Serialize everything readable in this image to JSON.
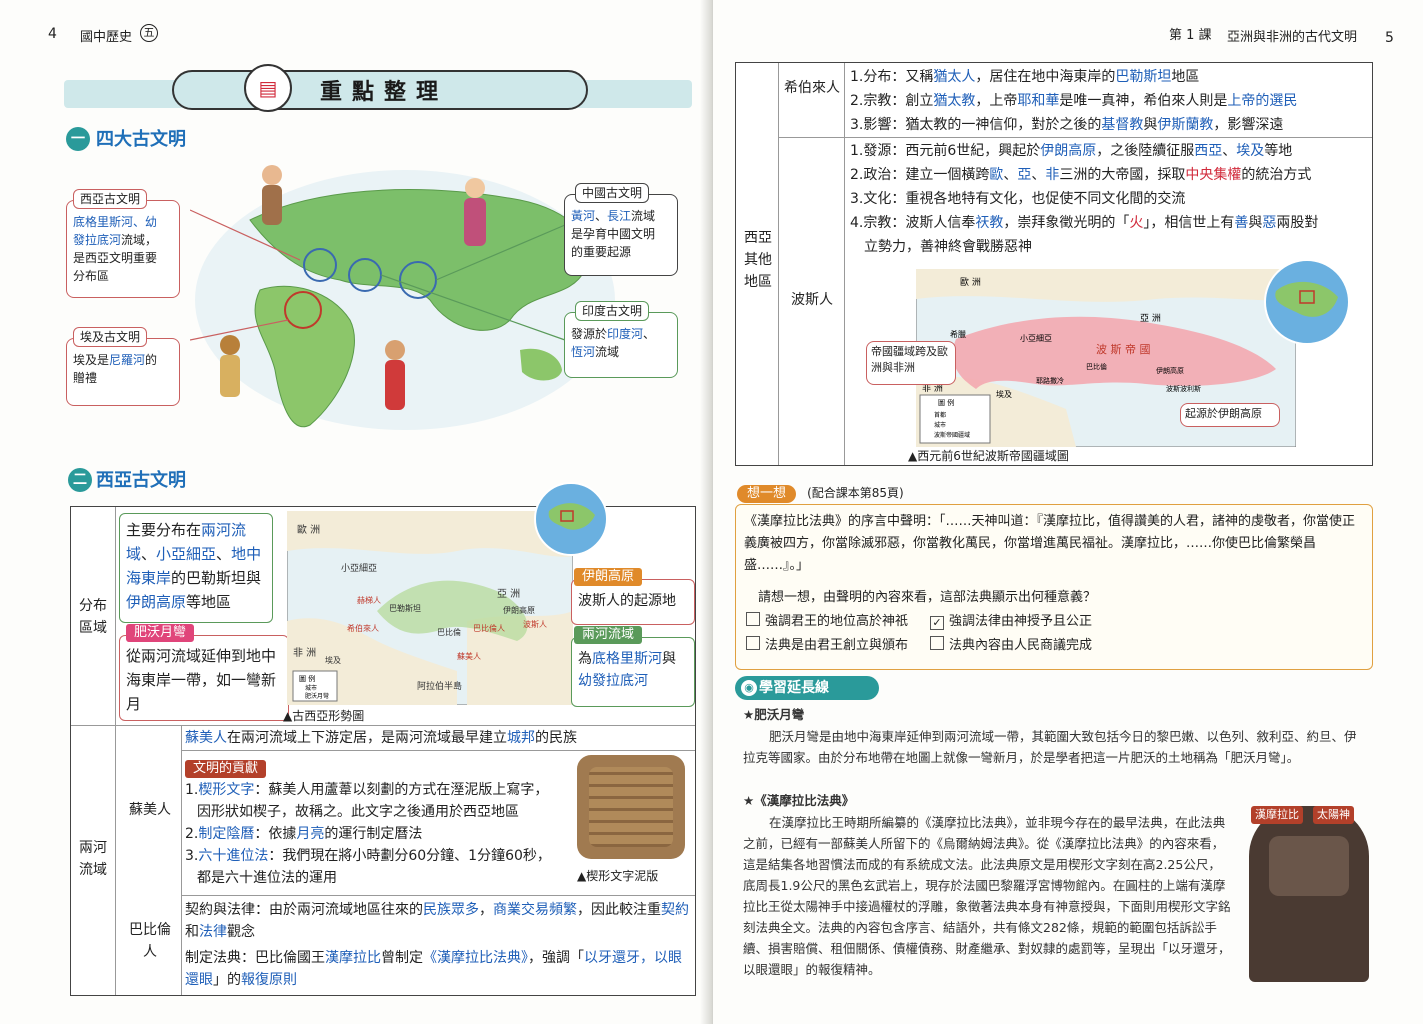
{
  "left_page": {
    "page_no": "4",
    "book_title": "國中歷史",
    "volume_mark": "五",
    "banner_title": "重點整理",
    "section1": {
      "num": "一",
      "title": "四大古文明"
    },
    "callouts": {
      "west_asia": {
        "title": "西亞古文明",
        "line1a": "底格里斯河、幼",
        "line2a": "發拉底河",
        "line2b": "流域，",
        "line3": "是西亞文明重要",
        "line4": "分布區"
      },
      "egypt": {
        "title": "埃及古文明",
        "line1a": "埃及是",
        "line1b": "尼羅河",
        "line1c": "的",
        "line2": "贈禮"
      },
      "china": {
        "title": "中國古文明",
        "line1a": "黃河",
        "line1b": "、",
        "line1c": "長江",
        "line1d": "流域",
        "line2": "是孕育中國文明",
        "line3": "的重要起源"
      },
      "india": {
        "title": "印度古文明",
        "line1a": "發源於",
        "line1b": "印度河",
        "line1c": "、",
        "line2a": "恆河",
        "line2b": "流域"
      }
    },
    "section2": {
      "num": "二",
      "title": "西亞古文明"
    },
    "table": {
      "dist_label": "分布區域",
      "dist_text": {
        "a": "主要分布在",
        "b": "兩河流域",
        "c": "、",
        "d": "小亞細亞",
        "e": "、",
        "f": "地中海東岸",
        "g": "的巴勒斯坦與",
        "h": "伊朗高原",
        "i": "等地區"
      },
      "fertile_tag": "肥沃月彎",
      "fertile_text": "從兩河流域延伸到地中海東岸一帶，如一彎新月",
      "iran_tag": "伊朗高原",
      "iran_text": "波斯人的起源地",
      "river_tag": "兩河流域",
      "river_text": {
        "a": "為",
        "b": "底格里斯河",
        "c": "與",
        "d": "幼發拉底河"
      },
      "map_caption": "▲古西亞形勢圖",
      "map_labels": {
        "europe": "歐 洲",
        "asia_minor": "小亞細亞",
        "hittite": "赫梯人",
        "hebrew": "希伯來人",
        "palestine": "巴勒斯坦",
        "babylon": "巴比倫",
        "babylonian": "巴比倫人",
        "sumer": "蘇美人",
        "africa": "非 洲",
        "egypt": "埃及",
        "arabia": "阿拉伯半島",
        "asia": "亞 洲",
        "iran": "伊朗高原",
        "persian": "波斯人",
        "legend_title": "圖 例",
        "legend_city": "城市",
        "legend_fertile": "肥沃月彎"
      },
      "two_rivers_label": "兩河流域",
      "sumer_label": "蘇美人",
      "sumer_intro": {
        "a": "蘇美人",
        "b": "在兩河流域上下游定居，是兩河流域最早建立",
        "c": "城邦",
        "d": "的民族"
      },
      "contrib_tag": "文明的貢獻",
      "contrib1": {
        "n": "1.",
        "a": "楔形文字",
        "b": "：蘇美人用蘆葦以刻劃的方式在溼泥版上寫字，",
        "c": "因形狀如楔子，故稱之。此文字之後通用於西亞地區"
      },
      "contrib2": {
        "n": "2.",
        "a": "制定陰曆",
        "b": "：依據",
        "c": "月亮",
        "d": "的運行制定曆法"
      },
      "contrib3": {
        "n": "3.",
        "a": "六十進位法",
        "b": "：我們現在將小時劃分60分鐘、1分鐘60秒，",
        "c": "都是六十進位法的運用"
      },
      "tablet_caption": "▲楔形文字泥版",
      "babylon_label": "巴比倫人",
      "babylon1": {
        "a": "契約與法律：由於兩河流域地區往來的",
        "b": "民族眾多",
        "c": "，",
        "d": "商業交易頻繁",
        "e": "，因此較注重",
        "f": "契約",
        "g": "和",
        "h": "法律",
        "i": "觀念"
      },
      "babylon2": {
        "a": "制定法典：巴比倫國王",
        "b": "漢摩拉比",
        "c": "曾制定",
        "d": "《漢摩拉比法典》",
        "e": "，強調「",
        "f": "以牙還牙，以眼還眼",
        "g": "」的",
        "h": "報復原則"
      }
    }
  },
  "right_page": {
    "page_no": "5",
    "lesson": "第 1 課",
    "lesson_title": "亞洲與非洲的古代文明",
    "region_label": "西亞其他地區",
    "hebrew": {
      "label": "希伯來人",
      "l1": {
        "a": "1.分布：又稱",
        "b": "猶太人",
        "c": "，居住在地中海東岸的",
        "d": "巴勒斯坦",
        "e": "地區"
      },
      "l2": {
        "a": "2.宗教：創立",
        "b": "猶太教",
        "c": "，上帝",
        "d": "耶和華",
        "e": "是唯一真神，希伯來人則是",
        "f": "上帝的選民"
      },
      "l3": {
        "a": "3.影響：猶太教的一神信仰，對於之後的",
        "b": "基督教",
        "c": "與",
        "d": "伊斯蘭教",
        "e": "，影響深遠"
      }
    },
    "persian": {
      "label": "波斯人",
      "l1": {
        "a": "1.發源：西元前6世紀，興起於",
        "b": "伊朗高原",
        "c": "，之後陸續征服",
        "d": "西亞",
        "e": "、",
        "f": "埃及",
        "g": "等地"
      },
      "l2": {
        "a": "2.政治：建立一個橫跨",
        "b": "歐",
        "c": "、",
        "d": "亞",
        "e": "、",
        "f": "非",
        "g": "三洲的大帝國，採取",
        "h": "中央集權",
        "i": "的統治方式"
      },
      "l3": "3.文化：重視各地特有文化，也促使不同文化間的交流",
      "l4": {
        "a": "4.宗教：波斯人信奉",
        "b": "祆教",
        "c": "，崇拜象徵光明的「",
        "d": "火",
        "e": "」，相信世上有",
        "f": "善",
        "g": "與",
        "h": "惡",
        "i": "兩股對"
      },
      "l4b": "立勢力，善神終會戰勝惡神",
      "map_caption": "▲西元前6世紀波斯帝國疆域圖",
      "callout_empire": "帝國疆域跨及歐洲與非洲",
      "callout_origin": "起源於伊朗高原",
      "map_labels": {
        "europe": "歐 洲",
        "asia": "亞 洲",
        "africa": "非 洲",
        "greece": "希臘",
        "asia_minor": "小亞細亞",
        "empire": "波 斯 帝 國",
        "babylon": "巴比倫",
        "iran": "伊朗高原",
        "persepolis": "波斯波利斯",
        "jerusalem": "耶路撒冷",
        "egypt": "埃及",
        "legend_title": "圖 例",
        "legend_capital": "首都",
        "legend_city": "城市",
        "legend_empire": "波斯帝國疆域"
      }
    },
    "think": {
      "tag": "想一想",
      "ref": "(配合課本第85頁)",
      "quote": "《漢摩拉比法典》的序言中聲明：「……天神叫道：『漢摩拉比，值得讚美的人君，諸神的虔敬者，你當使正義廣被四方，你當除滅邪惡，你當教化萬民，你當增進萬民福祉。漢摩拉比，……你使巴比倫繁榮昌盛……』。」",
      "question": "請想一想，由聲明的內容來看，這部法典顯示出何種意義？",
      "options": [
        "強調君王的地位高於神祇",
        "強調法律由神授予且公正",
        "法典是由君王創立與頒布",
        "法典內容由人民商議完成"
      ],
      "checked_mark": "✓"
    },
    "extension": {
      "title": "學習延長線",
      "item1_title": "★肥沃月彎",
      "item1_text": "肥沃月彎是由地中海東岸延伸到兩河流域一帶，其範圍大致包括今日的黎巴嫩、以色列、敘利亞、約旦、伊拉克等國家。由於分布地帶在地圖上就像一彎新月，於是學者把這一片肥沃的土地稱為「肥沃月彎」。",
      "item2_title": "★《漢摩拉比法典》",
      "item2_text": "在漢摩拉比王時期所編纂的《漢摩拉比法典》，並非現今存在的最早法典，在此法典之前，已經有一部蘇美人所留下的《烏爾納姆法典》。從《漢摩拉比法典》的內容來看，這是結集各地習慣法而成的有系統成文法。此法典原文是用楔形文字刻在高2.25公尺，底周長1.9公尺的黑色玄武岩上，現存於法國巴黎羅浮宮博物館內。在圓柱的上端有漢摩拉比王從太陽神手中接過權杖的浮雕，象徵著法典本身有神意授與，下面則用楔形文字銘刻法典全文。法典的內容包含序言、結語外，共有條文282條，規範的範圍包括訴訟手續、損害賠償、租佃關係、債權債務、財產繼承、對奴隸的處罰等，呈現出「以牙還牙，以眼還眼」的報復精神。",
      "stele_label1": "漢摩拉比",
      "stele_label2": "太陽神"
    }
  },
  "colors": {
    "accent_blue": "#1f5fb8",
    "accent_red": "#d12a3b",
    "teal": "#2a9a9a",
    "banner": "#cfe8ea"
  }
}
